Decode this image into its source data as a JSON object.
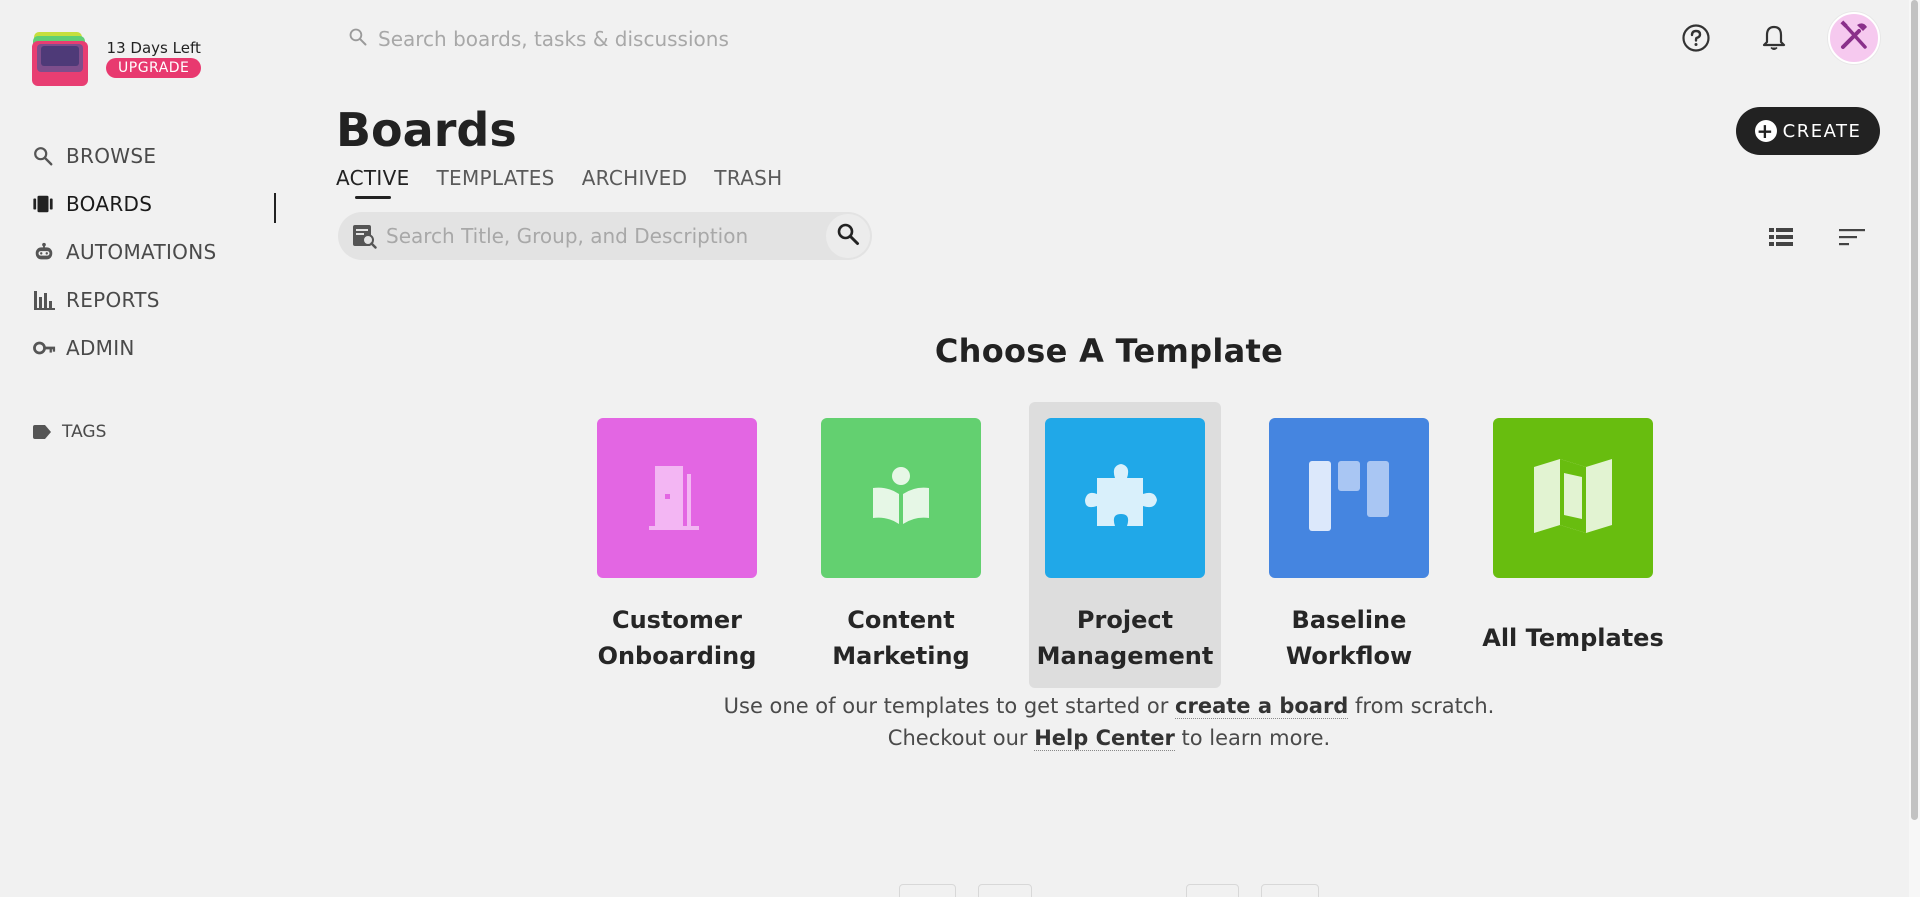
{
  "trial": {
    "days": "13",
    "label": "Days Left",
    "upgrade": "UPGRADE"
  },
  "sidebar": {
    "items": [
      {
        "label": "BROWSE",
        "icon": "search-icon"
      },
      {
        "label": "BOARDS",
        "icon": "boards-icon",
        "active": true
      },
      {
        "label": "AUTOMATIONS",
        "icon": "robot-icon"
      },
      {
        "label": "REPORTS",
        "icon": "bar-chart-icon"
      },
      {
        "label": "ADMIN",
        "icon": "key-icon"
      }
    ],
    "tags": {
      "label": "TAGS",
      "icon": "tag-icon"
    }
  },
  "topbar": {
    "search_placeholder": "Search boards, tasks & discussions",
    "icons": [
      "help-icon",
      "bell-icon",
      "avatar-tools-icon"
    ]
  },
  "header": {
    "title": "Boards",
    "create_label": "CREATE",
    "tabs": [
      {
        "label": "ACTIVE",
        "active": true
      },
      {
        "label": "TEMPLATES"
      },
      {
        "label": "ARCHIVED"
      },
      {
        "label": "TRASH"
      }
    ],
    "board_search_placeholder": "Search Title, Group, and Description"
  },
  "templates": {
    "title": "Choose A Template",
    "items": [
      {
        "line1": "Customer",
        "line2": "Onboarding",
        "color": "#e366e3",
        "icon": "door-icon"
      },
      {
        "line1": "Content",
        "line2": "Marketing",
        "color": "#63d070",
        "icon": "reading-icon"
      },
      {
        "line1": "Project",
        "line2": "Management",
        "color": "#20a8e8",
        "icon": "puzzle-icon",
        "selected": true
      },
      {
        "line1": "Baseline",
        "line2": "Workflow",
        "color": "#4585e0",
        "icon": "kanban-icon"
      },
      {
        "line1": "All Templates",
        "line2": "",
        "color": "#68bd0f",
        "icon": "map-icon"
      }
    ],
    "help": {
      "line1_pre": "Use one of our templates to get started or",
      "line1_link": "create a board",
      "line1_post": "from scratch.",
      "line2_pre": "Checkout our",
      "line2_link": "Help Center",
      "line2_post": "to learn more."
    }
  }
}
